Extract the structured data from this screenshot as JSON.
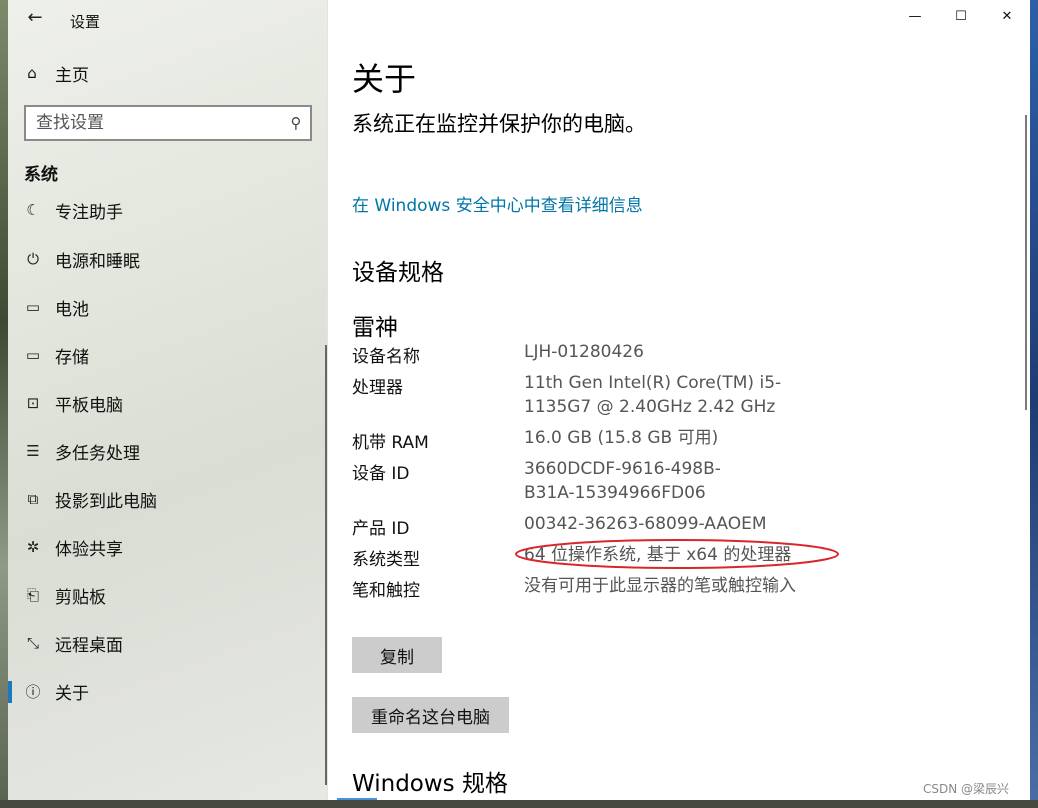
{
  "window": {
    "app_title": "设置",
    "back_icon": "back-arrow-icon",
    "caption": {
      "minimize_icon": "minimize-icon",
      "maximize_icon": "maximize-icon",
      "close_icon": "close-icon"
    }
  },
  "sidebar": {
    "home_label": "主页",
    "search_placeholder": "查找设置",
    "section_title": "系统",
    "items": [
      {
        "label": "专注助手",
        "icon": "focus-assist-icon"
      },
      {
        "label": "电源和睡眠",
        "icon": "power-icon"
      },
      {
        "label": "电池",
        "icon": "battery-icon"
      },
      {
        "label": "存储",
        "icon": "storage-icon"
      },
      {
        "label": "平板电脑",
        "icon": "tablet-icon"
      },
      {
        "label": "多任务处理",
        "icon": "multitasking-icon"
      },
      {
        "label": "投影到此电脑",
        "icon": "project-icon"
      },
      {
        "label": "体验共享",
        "icon": "share-icon"
      },
      {
        "label": "剪贴板",
        "icon": "clipboard-icon"
      },
      {
        "label": "远程桌面",
        "icon": "remote-desktop-icon"
      },
      {
        "label": "关于",
        "icon": "info-icon",
        "active": true
      }
    ]
  },
  "main": {
    "title": "关于",
    "security_text": "系统正在监控并保护你的电脑。",
    "security_link": "在 Windows 安全中心中查看详细信息",
    "device_specs_title": "设备规格",
    "device_name_heading": "雷神",
    "specs": [
      {
        "label": "设备名称",
        "value": "LJH-01280426"
      },
      {
        "label": "处理器",
        "value": "11th Gen Intel(R) Core(TM) i5-1135G7 @ 2.40GHz   2.42 GHz"
      },
      {
        "label": "机带 RAM",
        "value": "16.0 GB (15.8 GB 可用)"
      },
      {
        "label": "设备 ID",
        "value": "3660DCDF-9616-498B-B31A-15394966FD06"
      },
      {
        "label": "产品 ID",
        "value": "00342-36263-68099-AAOEM"
      },
      {
        "label": "系统类型",
        "value": "64 位操作系统, 基于 x64 的处理器"
      },
      {
        "label": "笔和触控",
        "value": "没有可用于此显示器的笔或触控输入"
      }
    ],
    "copy_button": "复制",
    "rename_button": "重命名这台电脑",
    "windows_specs_title": "Windows 规格",
    "annotation_color": "#d9262c"
  },
  "watermark": "CSDN @梁辰兴"
}
